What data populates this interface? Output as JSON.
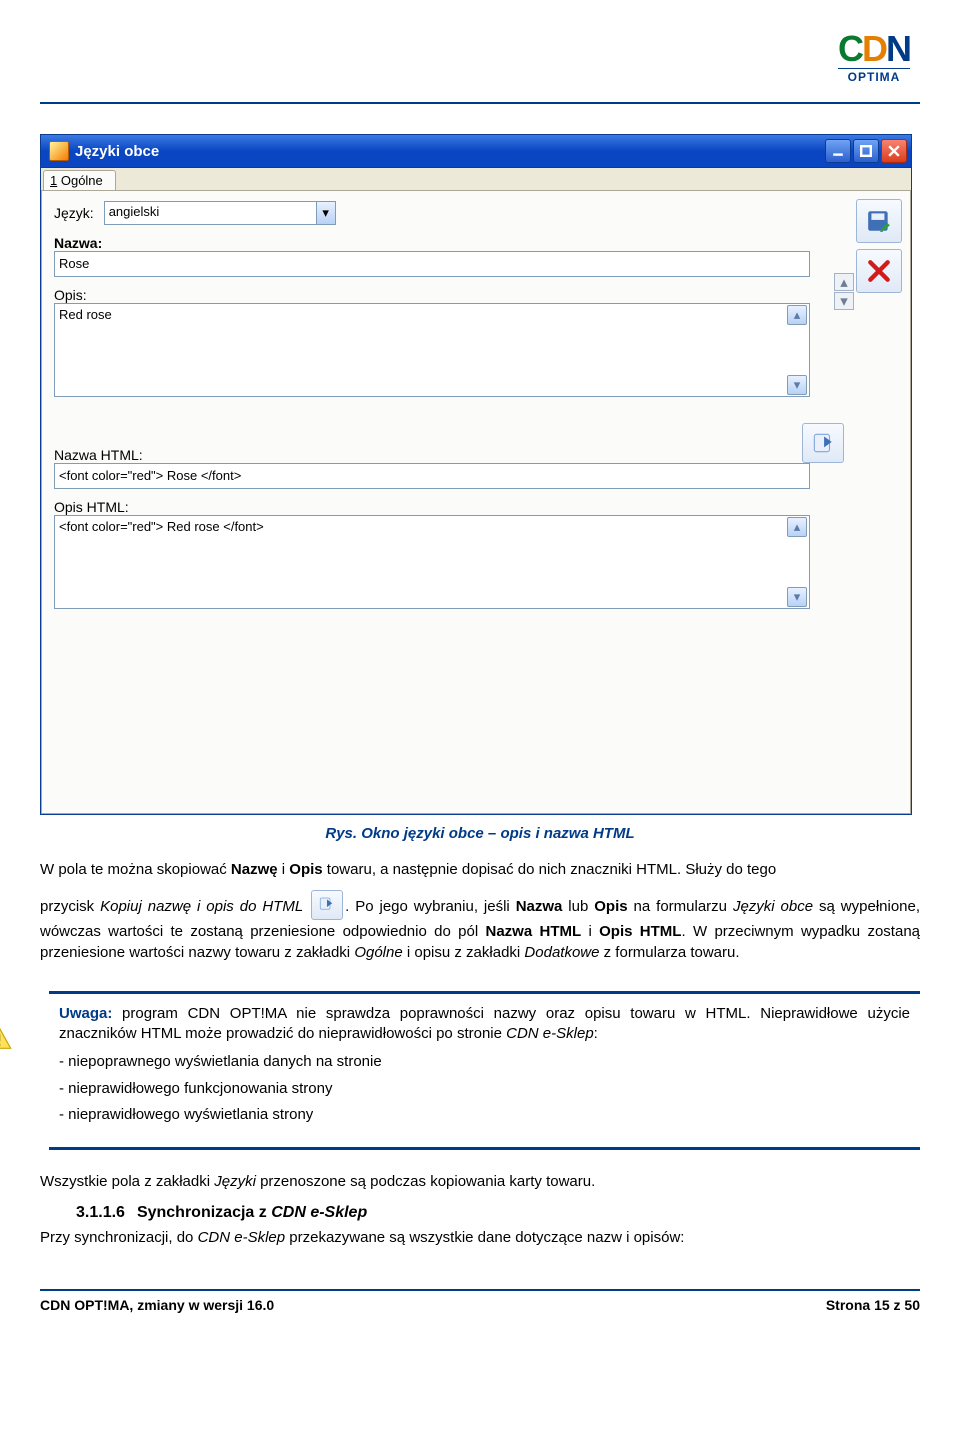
{
  "logo": {
    "letters": "CDN",
    "sub": "OPTIMA"
  },
  "window": {
    "title": "Języki obce",
    "tab_underline": "1",
    "tab_rest": " Ogólne",
    "labels": {
      "jezyk": "Język:",
      "nazwa": "Nazwa:",
      "opis": "Opis:",
      "nazwa_html": "Nazwa HTML:",
      "opis_html": "Opis HTML:"
    },
    "values": {
      "jezyk": "angielski",
      "nazwa": "Rose",
      "opis": "Red rose",
      "nazwa_html": "<font color=\"red\"> Rose </font>",
      "opis_html": "<font color=\"red\"> Red rose </font>"
    }
  },
  "caption": "Rys. Okno języki obce – opis i nazwa HTML",
  "para1": {
    "a": "W pola te można skopiować ",
    "b1": "Nazwę",
    "c": " i ",
    "b2": "Opis",
    "d": " towaru, a następnie dopisać do nich znaczniki HTML. Służy do tego"
  },
  "para2": {
    "a": "przycisk ",
    "it1": "Kopiuj nazwę i opis do HTML",
    "b": ". Po jego wybraniu, jeśli ",
    "b1": "Nazwa",
    "c": " lub ",
    "b2": "Opis",
    "d": " na formularzu ",
    "it2": "Języki obce",
    "e": " są wypełnione, wówczas wartości te zostaną przeniesione odpowiednio do pól ",
    "b3": "Nazwa HTML",
    "f": " i ",
    "b4": "Opis HTML",
    "g": ". W przeciwnym wypadku zostaną przeniesione wartości nazwy towaru z zakładki ",
    "it3": "Ogólne",
    "h": " i opisu z zakładki ",
    "it4": "Dodatkowe",
    "i": " z formularza towaru."
  },
  "warning": {
    "title": "Uwaga:",
    "text_a": " program CDN OPT!MA nie sprawdza poprawności nazwy oraz opisu towaru w HTML. Nieprawidłowe użycie znaczników HTML może prowadzić do nieprawidłowości po stronie ",
    "it": "CDN e-Sklep",
    "text_b": ":",
    "items": [
      "- niepoprawnego wyświetlania danych na stronie",
      "- nieprawidłowego funkcjonowania strony",
      "- nieprawidłowego wyświetlania strony"
    ]
  },
  "para3": {
    "a": "Wszystkie pola z zakładki ",
    "it": "Języki",
    "b": " przenoszone są podczas kopiowania karty towaru."
  },
  "heading": {
    "num": "3.1.1.6",
    "text_a": "Synchronizacja z ",
    "it": "CDN e-Sklep"
  },
  "para4": {
    "a": "Przy synchronizacji, do ",
    "it": "CDN e-Sklep",
    "b": " przekazywane są wszystkie dane dotyczące nazw i opisów:"
  },
  "footer": {
    "left": "CDN OPT!MA, zmiany w wersji 16.0",
    "right": "Strona 15 z 50"
  }
}
